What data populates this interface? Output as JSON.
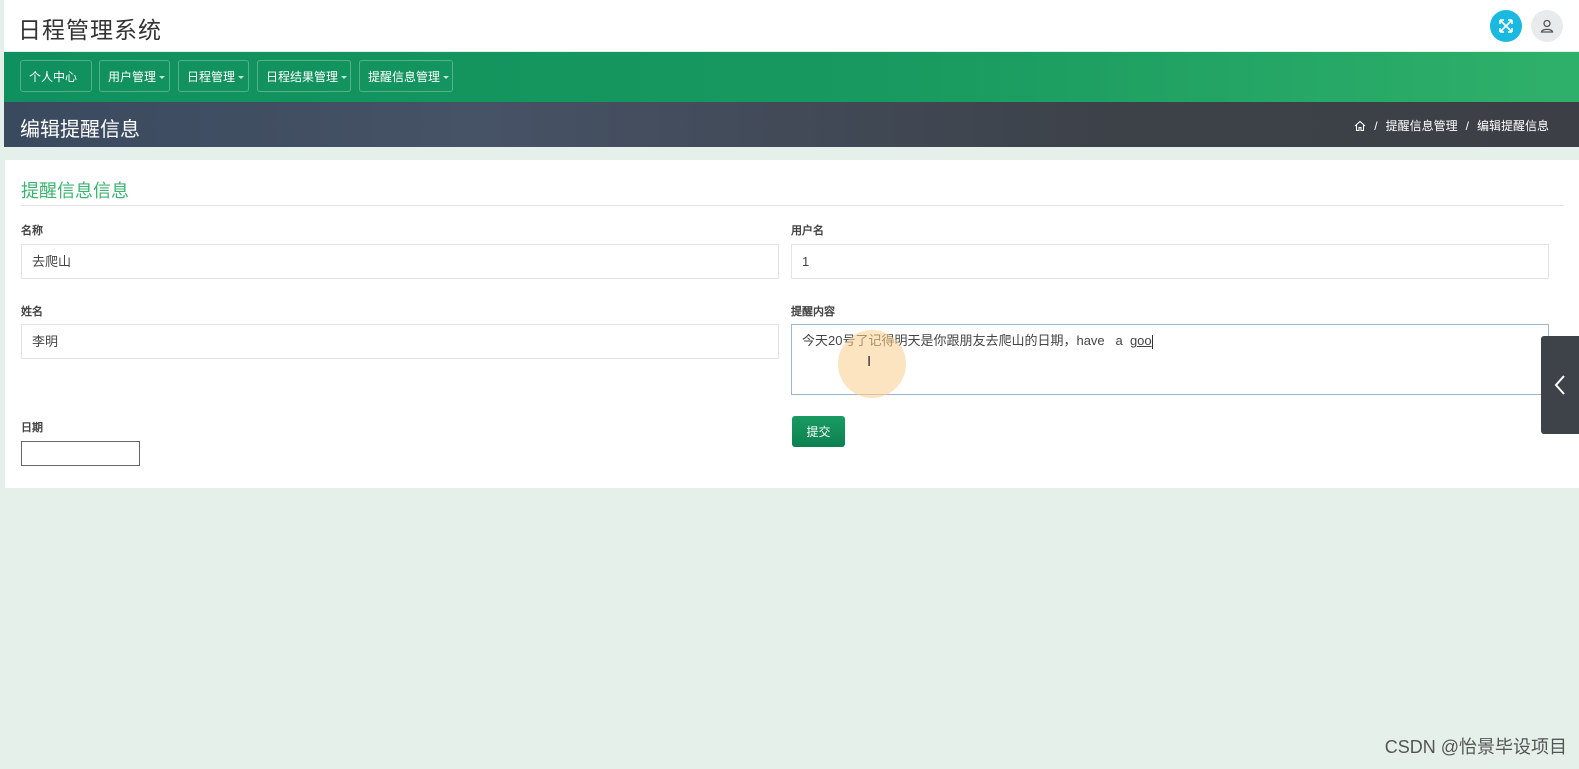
{
  "app": {
    "title": "日程管理系统"
  },
  "nav": {
    "items": [
      {
        "label": "个人中心",
        "has_dropdown": false
      },
      {
        "label": "用户管理",
        "has_dropdown": true
      },
      {
        "label": "日程管理",
        "has_dropdown": true
      },
      {
        "label": "日程结果管理",
        "has_dropdown": true
      },
      {
        "label": "提醒信息管理",
        "has_dropdown": true
      }
    ]
  },
  "page": {
    "title": "编辑提醒信息",
    "breadcrumb": [
      "提醒信息管理",
      "编辑提醒信息"
    ]
  },
  "form": {
    "section_title": "提醒信息信息",
    "name": {
      "label": "名称",
      "value": "去爬山"
    },
    "username": {
      "label": "用户名",
      "value": "1"
    },
    "realname": {
      "label": "姓名",
      "value": "李明"
    },
    "content": {
      "label": "提醒内容",
      "value_main": "今天20号了记得明天是你跟朋友去爬山的日期，have   a  ",
      "value_composing": "goo"
    },
    "date": {
      "label": "日期",
      "value": ""
    },
    "submit_label": "提交"
  },
  "watermark": "CSDN @怡景毕设项目",
  "colors": {
    "nav_green": "#10905e",
    "header_dark": "#3c4046",
    "accent_title": "#3cb371",
    "expand_button": "#19b9e0"
  },
  "icons": {
    "expand": "expand-arrows-icon",
    "user": "user-icon",
    "home": "home-icon",
    "side_tab": "chevron-left-icon"
  }
}
